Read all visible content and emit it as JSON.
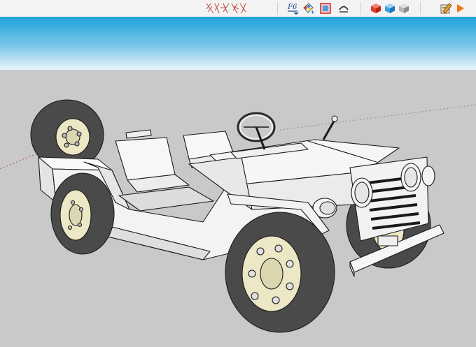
{
  "toolbar": {
    "font_tool_label": "F6",
    "items": [
      {
        "name": "x-ray-style",
        "icon": "xray-pattern-icon"
      },
      {
        "name": "3d-text",
        "icon": "3d-text-icon"
      },
      {
        "name": "paint-bucket",
        "icon": "paint-bucket-icon"
      },
      {
        "name": "section-plane",
        "icon": "section-plane-icon"
      },
      {
        "name": "follow-me",
        "icon": "follow-me-icon"
      },
      {
        "name": "component-red",
        "icon": "red-cube-icon"
      },
      {
        "name": "component-blue",
        "icon": "blue-cube-icon"
      },
      {
        "name": "component-gray",
        "icon": "gray-cube-icon"
      },
      {
        "name": "scene-tool",
        "icon": "scene-pencil-icon"
      },
      {
        "name": "play-animation",
        "icon": "play-icon"
      }
    ]
  },
  "colors": {
    "sky_top": "#1ea3d8",
    "sky_bottom": "#eaf5fb",
    "ground": "#c9c9cb",
    "body_face": "#f4f4f4",
    "tire": "#4a4a4a",
    "rim": "#ece7c4",
    "edge": "#1a1a1a"
  },
  "viewport": {
    "model": "jeep"
  }
}
